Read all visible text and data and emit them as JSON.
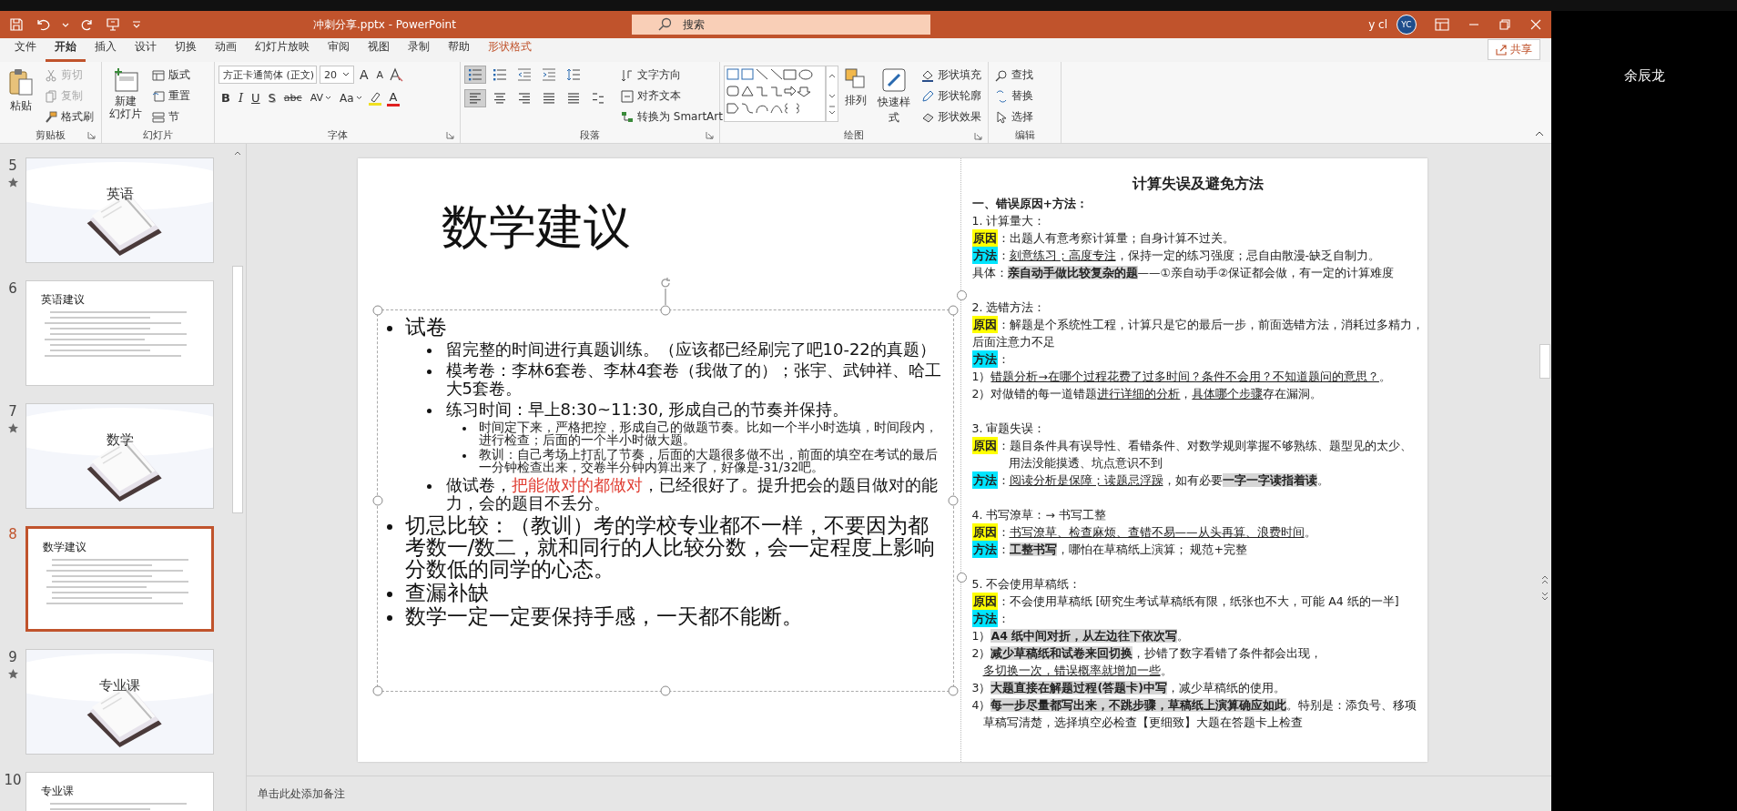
{
  "title_bar": {
    "file_title": "冲刺分享.pptx  -  PowerPoint",
    "search": {
      "placeholder": "搜索"
    },
    "user": "y cl",
    "avatar": "YC"
  },
  "menu_tabs": [
    {
      "label": "文件",
      "selected": false,
      "kind": "normal"
    },
    {
      "label": "开始",
      "selected": true,
      "kind": "normal"
    },
    {
      "label": "插入",
      "selected": false,
      "kind": "normal"
    },
    {
      "label": "设计",
      "selected": false,
      "kind": "normal"
    },
    {
      "label": "切换",
      "selected": false,
      "kind": "normal"
    },
    {
      "label": "动画",
      "selected": false,
      "kind": "normal"
    },
    {
      "label": "幻灯片放映",
      "selected": false,
      "kind": "normal"
    },
    {
      "label": "审阅",
      "selected": false,
      "kind": "normal"
    },
    {
      "label": "视图",
      "selected": false,
      "kind": "normal"
    },
    {
      "label": "录制",
      "selected": false,
      "kind": "normal"
    },
    {
      "label": "帮助",
      "selected": false,
      "kind": "normal"
    },
    {
      "label": "形状格式",
      "selected": false,
      "kind": "contextual"
    }
  ],
  "share_button": "共享",
  "ribbon": {
    "clipboard": {
      "label": "剪贴板",
      "paste": "粘贴",
      "cut": {
        "label": "剪切",
        "disabled": true
      },
      "copy": {
        "label": "复制",
        "disabled": true
      },
      "format_painter": {
        "label": "格式刷",
        "disabled": false
      }
    },
    "slides": {
      "label": "幻灯片",
      "new_slide": [
        "新建",
        "幻灯片"
      ],
      "layout": "版式",
      "reset": "重置",
      "section": "节"
    },
    "font": {
      "label": "字体",
      "font_name": "方正卡通简体 (正文)",
      "font_size": "20",
      "size_tools": [
        {
          "label": "A",
          "kind": "grow"
        },
        {
          "label": "A",
          "kind": "shrink"
        }
      ],
      "format_tools": [
        {
          "label": "B",
          "kind": "bold"
        },
        {
          "label": "I",
          "kind": "italic"
        },
        {
          "label": "U",
          "kind": "underline"
        },
        {
          "label": "S",
          "kind": "shadow"
        },
        {
          "label": "abc",
          "kind": "strike"
        },
        {
          "label": "AV",
          "kind": "spacing"
        },
        {
          "label": "Aa",
          "kind": "case"
        }
      ],
      "font_color": "A"
    },
    "paragraph": {
      "label": "段落",
      "list_buttons": [
        {
          "selected": true
        },
        {
          "selected": false
        },
        {
          "selected": false
        },
        {
          "selected": false
        },
        {
          "selected": false
        }
      ],
      "align_buttons": [
        {
          "selected": true
        },
        {
          "selected": false
        },
        {
          "selected": false
        },
        {
          "selected": false
        },
        {
          "selected": false
        },
        {
          "selected": false
        }
      ],
      "text_direction": "文字方向",
      "align_text": "对齐文本",
      "smartart": "转换为 SmartArt"
    },
    "drawing": {
      "label": "绘图",
      "arrange": "排列",
      "quick_styles": "快速样式",
      "shape_fill": "形状填充",
      "shape_outline": "形状轮廓",
      "shape_effects": "形状效果"
    },
    "editing": {
      "label": "编辑",
      "find": "查找",
      "replace": "替换",
      "select": "选择"
    }
  },
  "thumbnails": [
    {
      "number": "5",
      "animated": true,
      "kind": "section",
      "title": "英语",
      "selected": false
    },
    {
      "number": "6",
      "animated": false,
      "kind": "content",
      "title": "英语建议",
      "selected": false
    },
    {
      "number": "7",
      "animated": true,
      "kind": "section",
      "title": "数学",
      "selected": false
    },
    {
      "number": "8",
      "animated": false,
      "kind": "content",
      "title": "数学建议",
      "selected": true
    },
    {
      "number": "9",
      "animated": true,
      "kind": "section",
      "title": "专业课",
      "selected": false
    },
    {
      "number": "10",
      "animated": false,
      "kind": "content",
      "title": "专业课",
      "selected": false
    }
  ],
  "slide": {
    "title": "数学建议",
    "bullets": [
      {
        "runs": [
          {
            "text": "试卷",
            "emphasis": false
          }
        ],
        "children": [
          {
            "runs": [
              {
                "text": "留完整的时间进行真题训练。（应该都已经刷完了吧10-22的真题）",
                "emphasis": false
              }
            ]
          },
          {
            "runs": [
              {
                "text": "模考卷：李林6套卷、李林4套卷（我做了的）；张宇、武钟祥、哈工大5套卷。",
                "emphasis": false
              }
            ]
          },
          {
            "runs": [
              {
                "text": "练习时间：早上8:30~11:30, 形成自己的节奏并保持。",
                "emphasis": false
              }
            ],
            "children": [
              {
                "runs": [
                  {
                    "text": "时间定下来，严格把控，形成自己的做题节奏。比如一个半小时选填，时间段内，进行检查；后面的一个半小时做大题。",
                    "emphasis": false
                  }
                ]
              },
              {
                "runs": [
                  {
                    "text": "教训：自己考场上打乱了节奏，后面的大题很多做不出，前面的填空在考试的最后一分钟检查出来，交卷半分钟内算出来了，好像是-31/32吧。",
                    "emphasis": false
                  }
                ]
              }
            ]
          },
          {
            "runs": [
              {
                "text": "做试卷，",
                "emphasis": false
              },
              {
                "text": "把能做对的都做对",
                "emphasis": true
              },
              {
                "text": "，已经很好了。提升把会的题目做对的能力，会的题目不丢分。",
                "emphasis": false
              }
            ]
          }
        ]
      },
      {
        "runs": [
          {
            "text": "切忌比较：（教训）考的学校专业都不一样，不要因为都考数一/数二，就和同行的人比较分数，会一定程度上影响分数低的同学的心态。",
            "emphasis": false
          }
        ]
      },
      {
        "runs": [
          {
            "text": "查漏补缺",
            "emphasis": false
          }
        ]
      },
      {
        "runs": [
          {
            "text": "数学一定一定要保持手感，一天都不能断。",
            "emphasis": false
          }
        ]
      }
    ],
    "notes_title": "计算失误及避免方法",
    "notes_heading": "一、错误原因+方法：",
    "sections": [
      {
        "heading": "1. 计算量大：",
        "lines": [
          {
            "kind": "line",
            "tag": {
              "text": "原因",
              "color": "#ffff00"
            },
            "runs": [
              {
                "text": "：出题人有意考察计算量；自身计算不过关。",
                "kind": "plain"
              }
            ]
          },
          {
            "kind": "line",
            "tag": {
              "text": "方法",
              "color": "#00e5ff"
            },
            "runs": [
              {
                "text": "：",
                "kind": "plain"
              },
              {
                "text": "刻意练习；高度专注",
                "kind": "underline"
              },
              {
                "text": "，保持一定的练习强度；忌自由散漫-缺乏自制力。",
                "kind": "plain"
              }
            ]
          },
          {
            "kind": "line",
            "runs": [
              {
                "text": "具体：",
                "kind": "plain"
              },
              {
                "text": "亲自动手做比较复杂的题",
                "kind": "highlight"
              },
              {
                "text": "——①亲自动手②保证都会做，有一定的计算难度",
                "kind": "plain"
              }
            ]
          }
        ]
      },
      {
        "heading": "2. 选错方法：",
        "lines": [
          {
            "kind": "line",
            "tag": {
              "text": "原因",
              "color": "#ffff00"
            },
            "runs": [
              {
                "text": "：解题是个系统性工程，计算只是它的最后一步，前面选错方法，消耗过多精力，",
                "kind": "plain"
              }
            ]
          },
          {
            "kind": "wrap",
            "runs": [
              {
                "text": "后面注意力不足",
                "kind": "plain"
              }
            ]
          },
          {
            "kind": "line",
            "tag": {
              "text": "方法",
              "color": "#00e5ff"
            },
            "runs": [
              {
                "text": "：",
                "kind": "plain"
              }
            ]
          },
          {
            "kind": "line",
            "runs": [
              {
                "text": "1）",
                "kind": "plain"
              },
              {
                "text": "错题分析→在哪个过程花费了过多时间？条件不会用？不知道题问的意思？",
                "kind": "underline"
              },
              {
                "text": "。",
                "kind": "plain"
              }
            ]
          },
          {
            "kind": "line",
            "runs": [
              {
                "text": "2）对做错的每一道错题",
                "kind": "plain"
              },
              {
                "text": "进行详细的分析",
                "kind": "underline"
              },
              {
                "text": "，",
                "kind": "plain"
              },
              {
                "text": "具体哪个步骤",
                "kind": "underline"
              },
              {
                "text": "存在漏洞。",
                "kind": "plain"
              }
            ]
          }
        ]
      },
      {
        "heading": "3. 审题失误：",
        "lines": [
          {
            "kind": "line",
            "tag": {
              "text": "原因",
              "color": "#ffff00"
            },
            "runs": [
              {
                "text": "：题目条件具有误导性、看错条件、对数学规则掌握不够熟练、题型见的太少、",
                "kind": "plain"
              }
            ]
          },
          {
            "kind": "hang",
            "runs": [
              {
                "text": "用法没能摸透、坑点意识不到",
                "kind": "plain"
              }
            ]
          },
          {
            "kind": "line",
            "tag": {
              "text": "方法",
              "color": "#00e5ff"
            },
            "runs": [
              {
                "text": "：",
                "kind": "plain"
              },
              {
                "text": "阅读分析是保障；读题忌浮躁",
                "kind": "underline"
              },
              {
                "text": "，如有必要",
                "kind": "plain"
              },
              {
                "text": "一字一字读指着读",
                "kind": "highlight"
              },
              {
                "text": "。",
                "kind": "plain"
              }
            ]
          }
        ]
      },
      {
        "heading": "4. 书写潦草：→ 书写工整",
        "lines": [
          {
            "kind": "line",
            "tag": {
              "text": "原因",
              "color": "#ffff00"
            },
            "runs": [
              {
                "text": "：",
                "kind": "plain"
              },
              {
                "text": "书写潦草、检查麻烦、查错不易——从头再算、浪费时间",
                "kind": "underline"
              },
              {
                "text": "。",
                "kind": "plain"
              }
            ]
          },
          {
            "kind": "line",
            "tag": {
              "text": "方法",
              "color": "#00e5ff"
            },
            "runs": [
              {
                "text": "：",
                "kind": "plain"
              },
              {
                "text": "工整书写",
                "kind": "highlight"
              },
              {
                "text": "，哪怕在草稿纸上演算；        规范+完整",
                "kind": "plain"
              }
            ]
          }
        ]
      },
      {
        "heading": "5. 不会使用草稿纸：",
        "lines": [
          {
            "kind": "line",
            "tag": {
              "text": "原因",
              "color": "#ffff00"
            },
            "runs": [
              {
                "text": "：不会使用草稿纸 [研究生考试草稿纸有限，纸张也不大，可能 A4 纸的一半]",
                "kind": "plain"
              }
            ]
          },
          {
            "kind": "line",
            "tag": {
              "text": "方法",
              "color": "#00e5ff"
            },
            "runs": [
              {
                "text": "：",
                "kind": "plain"
              }
            ]
          },
          {
            "kind": "line",
            "runs": [
              {
                "text": "1）",
                "kind": "plain"
              },
              {
                "text": "A4 纸中间对折，从左边往下依次写",
                "kind": "highlight"
              },
              {
                "text": "。",
                "kind": "plain"
              }
            ]
          },
          {
            "kind": "line",
            "runs": [
              {
                "text": "2）",
                "kind": "plain"
              },
              {
                "text": "减少草稿纸和试卷来回切换",
                "kind": "highlight"
              },
              {
                "text": "，抄错了数字看错了条件都会出现，",
                "kind": "plain"
              }
            ]
          },
          {
            "kind": "indent",
            "runs": [
              {
                "text": "多切换一次，错误概率就增加一些",
                "kind": "underline"
              },
              {
                "text": "。",
                "kind": "plain"
              }
            ]
          },
          {
            "kind": "line",
            "runs": [
              {
                "text": "3）",
                "kind": "plain"
              },
              {
                "text": "大题直接在解题过程(答题卡)中写",
                "kind": "highlight"
              },
              {
                "text": "，减少草稿纸的使用。",
                "kind": "plain"
              }
            ]
          },
          {
            "kind": "line",
            "runs": [
              {
                "text": "4）",
                "kind": "plain"
              },
              {
                "text": "每一步尽量都写出来，不跳步骤，草稿纸上演算确应如此",
                "kind": "highlight"
              },
              {
                "text": "。特别是：添负号、移项",
                "kind": "plain"
              }
            ]
          },
          {
            "kind": "indent",
            "runs": [
              {
                "text": "草稿写清楚，选择填空必检查【更细致】大题在答题卡上检查",
                "kind": "plain"
              }
            ]
          }
        ]
      }
    ]
  },
  "notes": {
    "placeholder": "单击此处添加备注"
  },
  "participant": {
    "name": "余辰龙"
  }
}
